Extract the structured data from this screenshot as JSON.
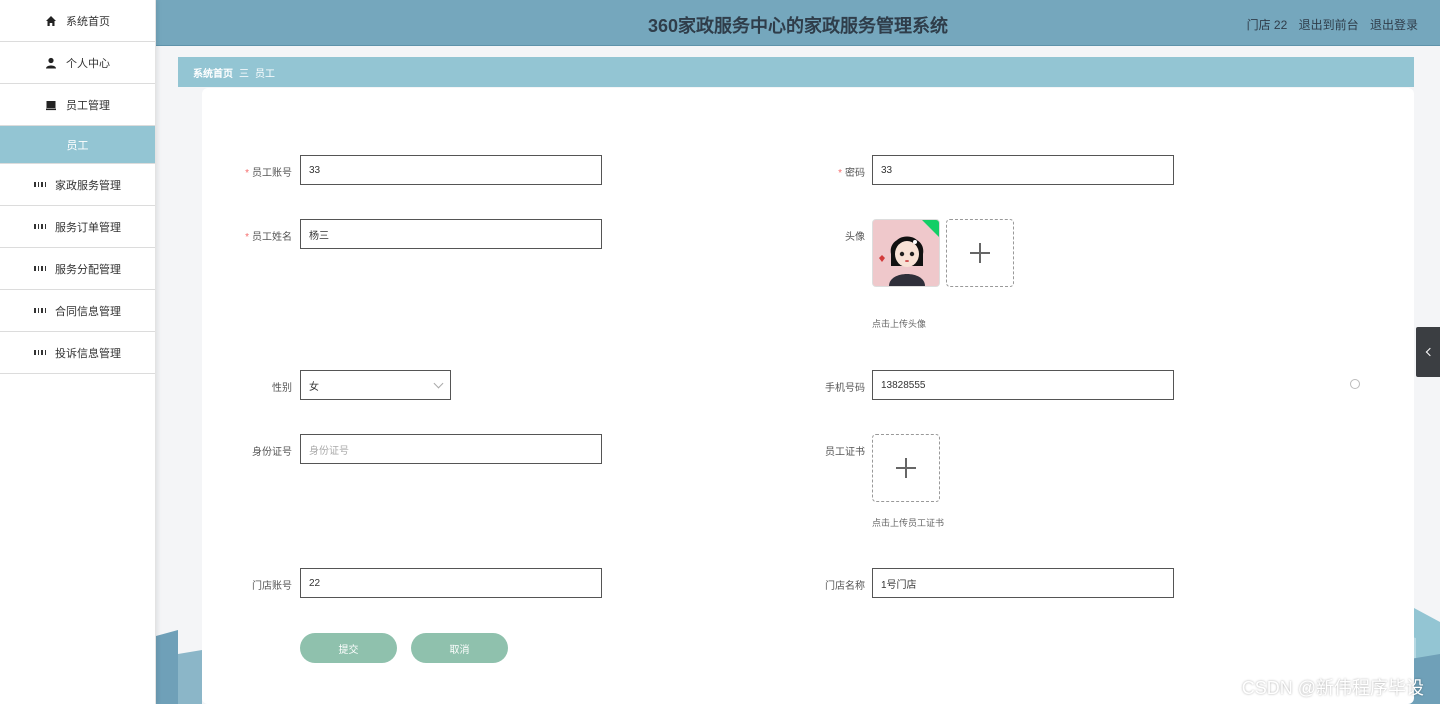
{
  "app": {
    "title": "360家政服务中心的家政服务管理系统"
  },
  "header": {
    "store_label": "门店 22",
    "back_frontend": "退出到前台",
    "logout": "退出登录"
  },
  "sidebar": {
    "items": [
      {
        "label": "系统首页",
        "icon": "home-icon"
      },
      {
        "label": "个人中心",
        "icon": "user-icon"
      },
      {
        "label": "员工管理",
        "icon": "folder-icon"
      },
      {
        "label": "员工",
        "icon": "",
        "active": true
      },
      {
        "label": "家政服务管理",
        "icon": "grid-icon"
      },
      {
        "label": "服务订单管理",
        "icon": "grid-icon"
      },
      {
        "label": "服务分配管理",
        "icon": "grid-icon"
      },
      {
        "label": "合同信息管理",
        "icon": "grid-icon"
      },
      {
        "label": "投诉信息管理",
        "icon": "grid-icon"
      }
    ]
  },
  "breadcrumb": {
    "home": "系统首页",
    "separator": "三",
    "current": "员工"
  },
  "form": {
    "account": {
      "label": "员工账号",
      "value": "33",
      "required": true
    },
    "password": {
      "label": "密码",
      "value": "33",
      "required": true
    },
    "name": {
      "label": "员工姓名",
      "value": "杨三",
      "required": true
    },
    "avatar": {
      "label": "头像",
      "hint": "点击上传头像"
    },
    "gender": {
      "label": "性别",
      "value": "女"
    },
    "phone": {
      "label": "手机号码",
      "value": "13828555"
    },
    "id_card": {
      "label": "身份证号",
      "placeholder": "身份证号"
    },
    "certificate": {
      "label": "员工证书",
      "hint": "点击上传员工证书"
    },
    "store_account": {
      "label": "门店账号",
      "value": "22"
    },
    "store_name": {
      "label": "门店名称",
      "value": "1号门店"
    },
    "submit": "提交",
    "cancel": "取消"
  },
  "watermark": "CSDN @新伟程序毕设",
  "colors": {
    "header_bg": "#75a7bd",
    "sidebar_active": "#93c5d3",
    "button_bg": "#8fc1ad",
    "required": "#f56c6c"
  }
}
